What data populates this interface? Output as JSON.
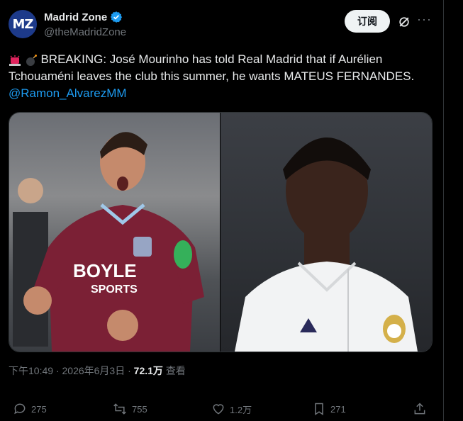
{
  "author": {
    "display_name": "Madrid Zone",
    "handle": "@theMadridZone",
    "avatar_text": "MZ",
    "verified": true
  },
  "header": {
    "follow_label": "订阅"
  },
  "tweet": {
    "text": "BREAKING: José Mourinho has told Real Madrid that if Aurélien Tchouaméni leaves the club this summer, he wants MATEUS FERNANDES.",
    "mention": "@Ramon_AlvarezMM"
  },
  "media": {
    "left_shirt_sponsor": "BOYLE",
    "left_shirt_sponsor_sub": "SPORTS"
  },
  "meta": {
    "time": "下午10:49",
    "separator1": "·",
    "date": "2026年6月3日",
    "separator2": "·",
    "views_count": "72.1万",
    "views_label": "查看"
  },
  "actions": {
    "replies": "275",
    "reposts": "755",
    "likes": "1.2万",
    "bookmarks": "271"
  },
  "colors": {
    "accent": "#1d9bf0",
    "verified": "#1d9bf0",
    "muted": "#71767b"
  }
}
